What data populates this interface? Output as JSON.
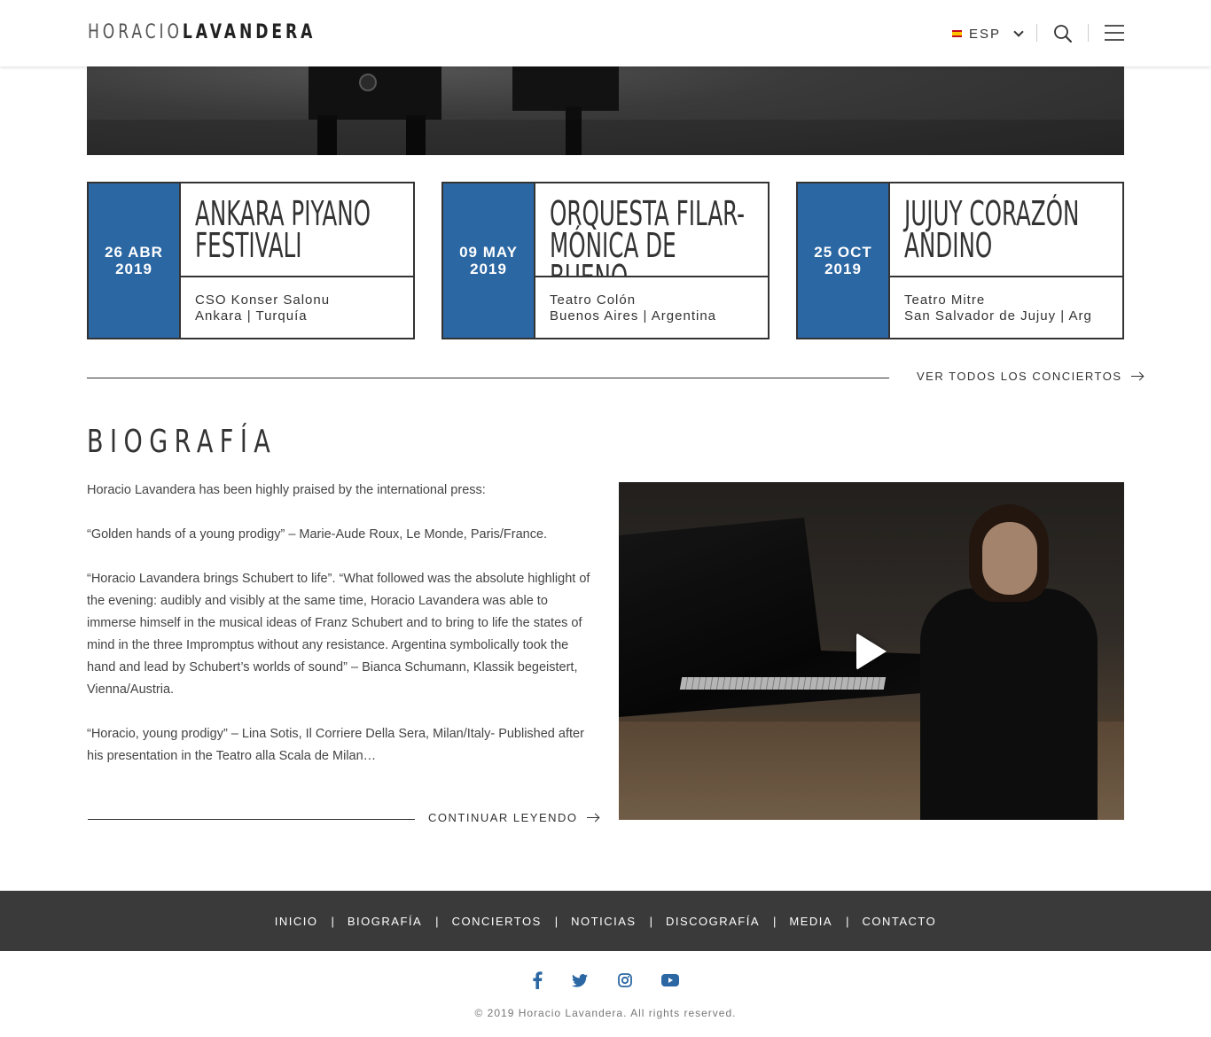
{
  "header": {
    "logo_light": "HORACIO",
    "logo_bold": "LAVANDERA",
    "language": "ESP"
  },
  "concerts": [
    {
      "day_month": "26 ABR",
      "year": "2019",
      "title": "ANKARA PIYANO FESTIVALI",
      "venue": "CSO Konser Salonu",
      "location": "Ankara | Turquía"
    },
    {
      "day_month": "09 MAY",
      "year": "2019",
      "title": "ORQUESTA FILAR-\nMÓNICA DE BUENO...",
      "venue": "Teatro Colón",
      "location": "Buenos Aires  | Argentina"
    },
    {
      "day_month": "25 OCT",
      "year": "2019",
      "title": "JUJUY CORAZÓN ANDINO",
      "venue": "Teatro Mitre",
      "location": "San Salvador de Jujuy | Arg"
    }
  ],
  "see_all_concerts": "VER TODOS LOS CONCIERTOS",
  "biography": {
    "heading": "BIOGRAFÍA",
    "paragraphs": [
      "Horacio Lavandera has been highly praised by the international press:",
      "“Golden hands of a young prodigy” – Marie-Aude Roux, Le Monde, Paris/France.",
      "“Horacio Lavandera brings Schubert to life”. “What followed was the absolute highlight of the evening: audibly and visibly at the same time, Horacio Lavandera was able to immerse himself in the musical ideas of Franz Schubert and to bring to life the states of mind in the three Impromptus without any resistance. Argentina symbolically took the hand and lead by Schubert’s worlds of sound” – Bianca Schumann, Klassik begeistert,  Vienna/Austria.",
      "“Horacio, young prodigy” – Lina Sotis, Il Corriere Della Sera, Milan/Italy- Published after his presentation in the Teatro alla Scala de Milan…"
    ],
    "continue_reading": "CONTINUAR LEYENDO"
  },
  "footer": {
    "nav": [
      "INICIO",
      "BIOGRAFÍA",
      "CONCIERTOS",
      "NOTICIAS",
      "DISCOGRAFÍA",
      "MEDIA",
      "CONTACTO"
    ],
    "social_icons": [
      "facebook-icon",
      "twitter-icon",
      "instagram-icon",
      "youtube-icon"
    ],
    "copyright": "© 2019 Horacio Lavandera. All rights reserved."
  },
  "colors": {
    "accent": "#2b67a3",
    "footer_bg": "#3a3a3a"
  }
}
